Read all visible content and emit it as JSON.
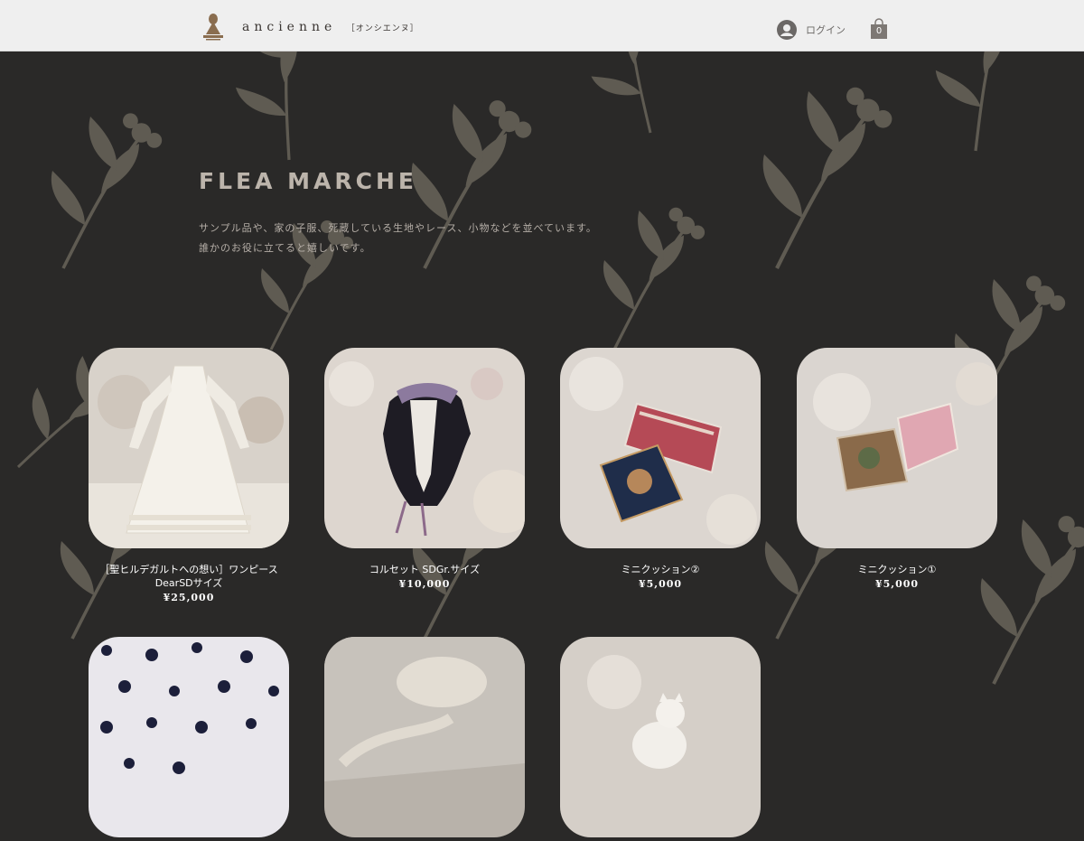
{
  "header": {
    "brand": "ancienne",
    "brand_sub": "［オンシエンヌ］",
    "login_label": "ログイン",
    "cart_count": "0"
  },
  "section": {
    "title": "FLEA MARCHE",
    "desc_line1": "サンプル品や、家の子服、死蔵している生地やレース、小物などを並べています。",
    "desc_line2": "誰かのお役に立てると嬉しいです。"
  },
  "products": [
    {
      "name_line1": "［聖ヒルデガルトへの想い］ワンピース",
      "name_line2": "DearSDサイズ",
      "price": "¥25,000"
    },
    {
      "name_line1": "コルセット SDGr.サイズ",
      "name_line2": "",
      "price": "¥10,000"
    },
    {
      "name_line1": "ミニクッション②",
      "name_line2": "",
      "price": "¥5,000"
    },
    {
      "name_line1": "ミニクッション①",
      "name_line2": "",
      "price": "¥5,000"
    }
  ],
  "colors": {
    "background": "#2a2928",
    "header": "#efefef",
    "title": "#bcb4ab",
    "botanical": "#5f5b52"
  }
}
